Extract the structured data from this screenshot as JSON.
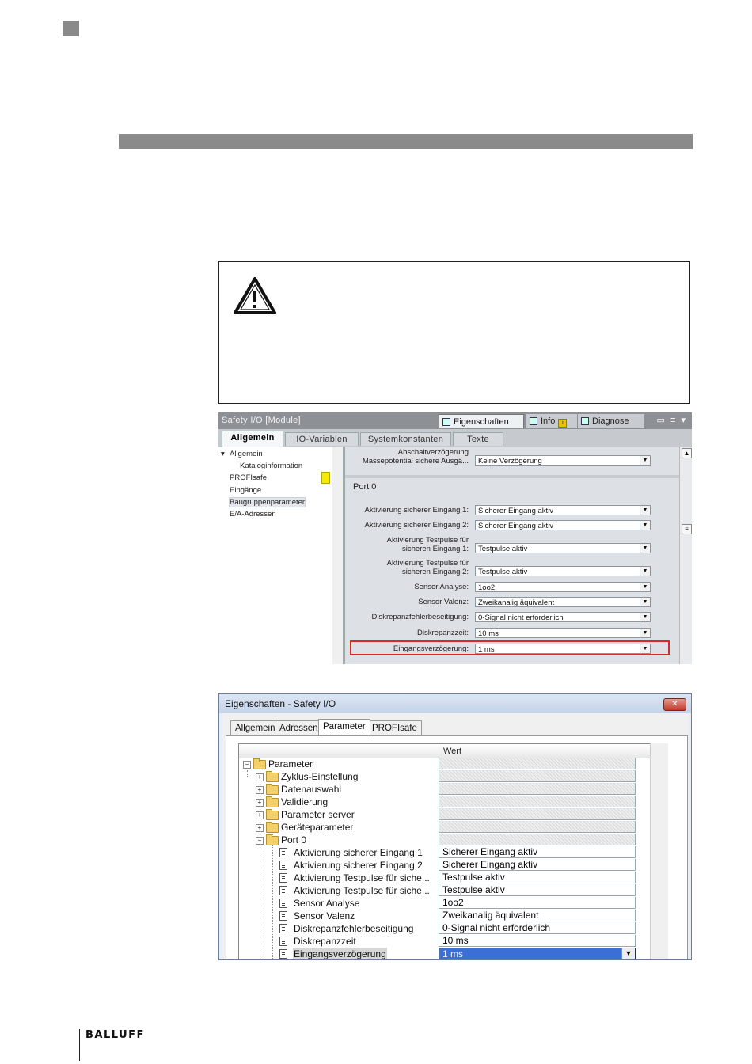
{
  "logo": "BALLUFF",
  "tia_panel": {
    "title": "Safety I/O [Module]",
    "top_tabs": [
      "Eigenschaften",
      "Info",
      "Diagnose"
    ],
    "sub_tabs": [
      "Allgemein",
      "IO-Variablen",
      "Systemkonstanten",
      "Texte"
    ],
    "nav_items": [
      "Allgemein",
      "Kataloginformation",
      "PROFIsafe",
      "Eingänge",
      "Baugruppenparameter",
      "E/A-Adressen"
    ],
    "top_property": {
      "label_line1": "Abschaltverzögerung",
      "label_line2": "Massepotential sichere Ausgä...",
      "value": "Keine Verzögerung"
    },
    "port_heading": "Port 0",
    "properties": [
      {
        "label1": "Aktivierung sicherer Eingang 1:",
        "label2": "",
        "value": "Sicherer Eingang aktiv"
      },
      {
        "label1": "Aktivierung sicherer Eingang 2:",
        "label2": "",
        "value": "Sicherer Eingang aktiv"
      },
      {
        "label1": "Aktivierung Testpulse für",
        "label2": "sicheren Eingang 1:",
        "value": "Testpulse aktiv"
      },
      {
        "label1": "Aktivierung Testpulse für",
        "label2": "sicheren Eingang 2:",
        "value": "Testpulse aktiv"
      },
      {
        "label1": "Sensor Analyse:",
        "label2": "",
        "value": "1oo2"
      },
      {
        "label1": "Sensor Valenz:",
        "label2": "",
        "value": "Zweikanalig äquivalent"
      },
      {
        "label1": "Diskrepanzfehlerbeseitigung:",
        "label2": "",
        "value": "0-Signal nicht erforderlich"
      },
      {
        "label1": "Diskrepanzzeit:",
        "label2": "",
        "value": "10 ms"
      },
      {
        "label1": "Eingangsverzögerung:",
        "label2": "",
        "value": "1 ms"
      }
    ]
  },
  "dialog": {
    "title": "Eigenschaften - Safety I/O",
    "close_label": "✕",
    "tabs": [
      "Allgemein",
      "Adressen",
      "Parameter",
      "PROFIsafe"
    ],
    "value_header": "Wert",
    "tree": [
      {
        "label": "Parameter",
        "value": ""
      },
      {
        "label": "Zyklus-Einstellung",
        "value": ""
      },
      {
        "label": "Datenauswahl",
        "value": ""
      },
      {
        "label": "Validierung",
        "value": ""
      },
      {
        "label": "Parameter server",
        "value": ""
      },
      {
        "label": "Geräteparameter",
        "value": ""
      },
      {
        "label": "Port 0",
        "value": ""
      },
      {
        "label": "Aktivierung sicherer Eingang 1",
        "value": "Sicherer Eingang aktiv"
      },
      {
        "label": "Aktivierung sicherer Eingang 2",
        "value": "Sicherer Eingang aktiv"
      },
      {
        "label": "Aktivierung Testpulse für siche...",
        "value": "Testpulse aktiv"
      },
      {
        "label": "Aktivierung Testpulse für siche...",
        "value": "Testpulse aktiv"
      },
      {
        "label": "Sensor Analyse",
        "value": "1oo2"
      },
      {
        "label": "Sensor Valenz",
        "value": "Zweikanalig äquivalent"
      },
      {
        "label": "Diskrepanzfehlerbeseitigung",
        "value": "0-Signal nicht erforderlich"
      },
      {
        "label": "Diskrepanzzeit",
        "value": "10 ms"
      },
      {
        "label": "Eingangsverzögerung",
        "value": "1 ms"
      }
    ]
  }
}
